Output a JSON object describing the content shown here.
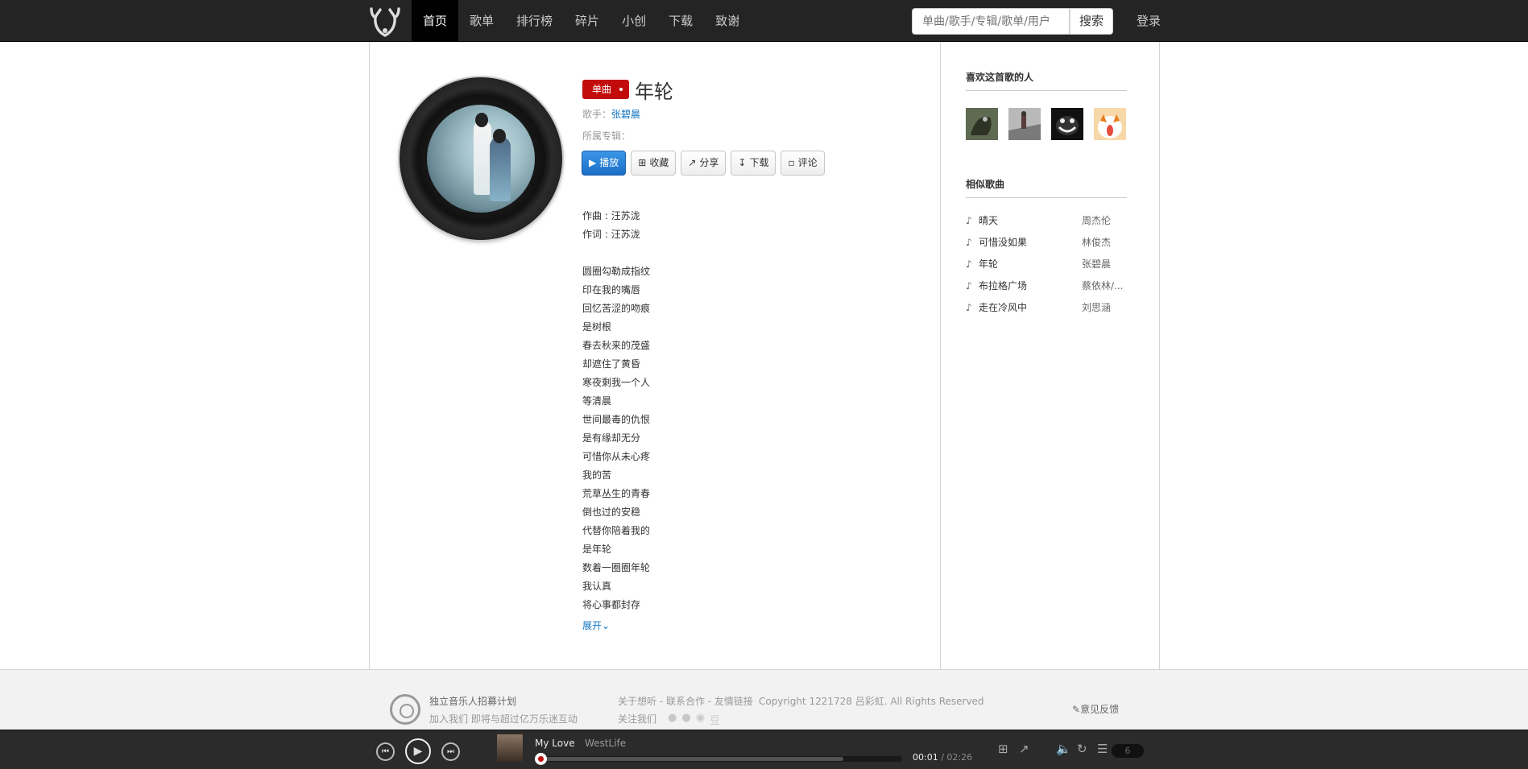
{
  "nav": {
    "items": [
      "首页",
      "歌单",
      "排行榜",
      "碎片",
      "小创",
      "下载",
      "致谢"
    ],
    "search_placeholder": "单曲/歌手/专辑/歌单/用户",
    "search_button": "搜索",
    "login": "登录"
  },
  "song": {
    "tag": "单曲",
    "title": "年轮",
    "singer_label": "歌手：",
    "singer": "张碧晨",
    "album_label": "所属专辑："
  },
  "actions": {
    "play": "播放",
    "collect": "收藏",
    "share": "分享",
    "download": "下载",
    "comment": "评论"
  },
  "lyrics": {
    "credits": [
      "作曲 : 汪苏泷",
      "作词 : 汪苏泷"
    ],
    "lines": [
      "圆圈勾勒成指纹",
      "印在我的嘴唇",
      "回忆苦涩的吻痕",
      "是树根",
      "春去秋来的茂盛",
      "却遮住了黄昏",
      "寒夜剩我一个人",
      "等清晨",
      "世间最毒的仇恨",
      "是有缘却无分",
      "可惜你从未心疼",
      "我的苦",
      "荒草丛生的青春",
      "倒也过的安稳",
      "代替你陪着我的",
      "是年轮",
      "数着一圈圈年轮",
      "我认真",
      "将心事都封存"
    ],
    "expand": "展开"
  },
  "sidebar": {
    "likes_title": "喜欢这首歌的人",
    "similar_title": "相似歌曲",
    "similar": [
      {
        "name": "晴天",
        "artist": "周杰伦"
      },
      {
        "name": "可惜没如果",
        "artist": "林俊杰"
      },
      {
        "name": "年轮",
        "artist": "张碧晨"
      },
      {
        "name": "布拉格广场",
        "artist": "蔡依林/..."
      },
      {
        "name": "走在冷风中",
        "artist": "刘思涵"
      }
    ]
  },
  "footer": {
    "recruit_title": "独立音乐人招募计划",
    "recruit_sub": "加入我们 即将与超过亿万乐迷互动",
    "links": "关于想听 - 联系合作 - 友情链接",
    "copyright": "Copyright 1221728 吕彩虹. All Rights Reserved",
    "follow": "关注我们",
    "feedback": "意见反馈"
  },
  "player": {
    "song": "My Love",
    "artist": "WestLife",
    "current": "00:01",
    "sep": " / ",
    "duration": "02:26",
    "progress": 0.005,
    "buffered": 0.84,
    "playlist_count": "6"
  },
  "colors": {
    "accent_red": "#c20c0c",
    "link_blue": "#0c73c2",
    "topbar": "#242424"
  }
}
